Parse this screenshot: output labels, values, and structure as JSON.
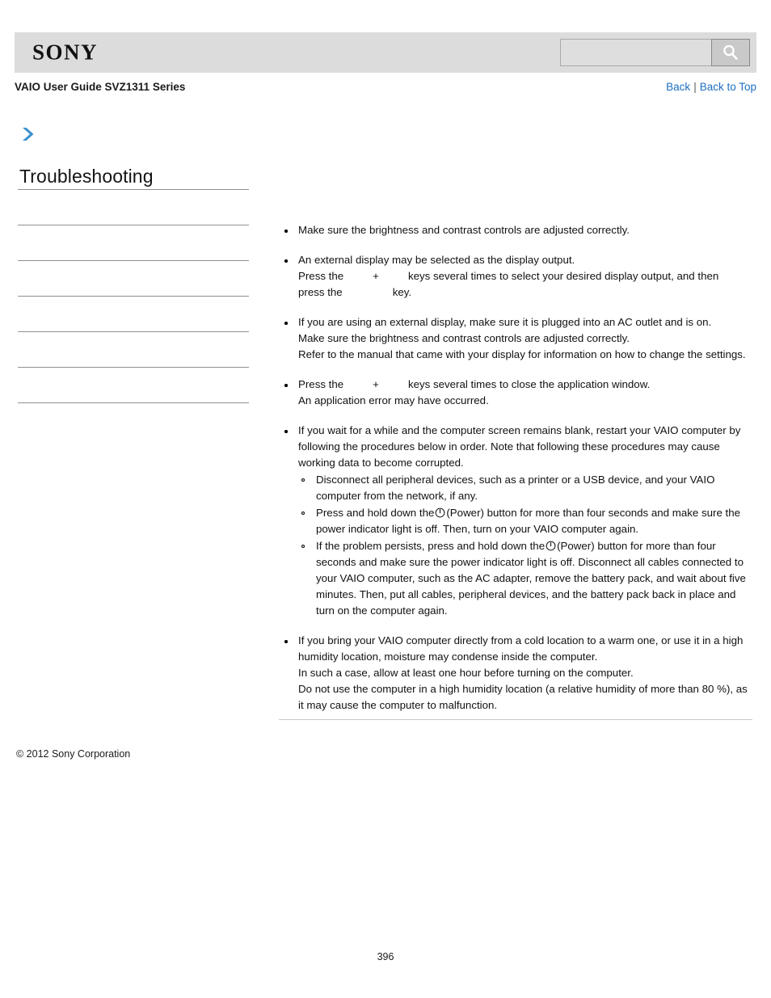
{
  "header": {
    "logo_text": "SONY",
    "search": {
      "value": "",
      "placeholder": "",
      "button_icon": "search-icon"
    },
    "guide_title": "VAIO User Guide SVZ1311 Series",
    "links": {
      "back": "Back",
      "separator": "|",
      "back_to_top": "Back to Top"
    },
    "link_color": "#1d6fc1",
    "bar_color": "#dcdcdc"
  },
  "sidebar": {
    "arrow_icon": "chevron-right-icon",
    "arrow_color": "#3a8fce",
    "heading": "Troubleshooting",
    "items": [
      {
        "label": ""
      },
      {
        "label": ""
      },
      {
        "label": ""
      },
      {
        "label": ""
      },
      {
        "label": ""
      },
      {
        "label": ""
      }
    ]
  },
  "content": {
    "bullets": [
      {
        "lines": [
          "Make sure the brightness and contrast controls are adjusted correctly."
        ]
      },
      {
        "lines": [
          "An external display may be selected as the display output.",
          "Press the",
          "keys several times to select your desired display output, and then",
          "press the",
          "key."
        ]
      },
      {
        "lines": [
          "If you are using an external display, make sure it is plugged into an AC outlet and is on.",
          "Make sure the brightness and contrast controls are adjusted correctly.",
          "Refer to the manual that came with your display for information on how to change the settings."
        ]
      },
      {
        "lines": [
          "Press the",
          "keys several times to close the application window.",
          "An application error may have occurred."
        ]
      },
      {
        "lines": [
          "If you wait for a while and the computer screen remains blank, restart your VAIO computer by following the procedures below in order. Note that following these procedures may cause working data to become corrupted."
        ],
        "sub_bullets": [
          "Disconnect all peripheral devices, such as a printer or a USB device, and your VAIO computer from the network, if any.",
          "Press and hold down the",
          "(Power) button for more than four seconds and make sure the power indicator light is off. Then, turn on your VAIO computer again.",
          "If the problem persists, press and hold down the",
          "(Power) button for more than four seconds and make sure the power indicator light is off. Disconnect all cables connected to your VAIO computer, such as the AC adapter, remove the battery pack, and wait about five minutes. Then, put all cables, peripheral devices, and the battery pack back in place and turn on the computer again."
        ]
      },
      {
        "lines": [
          "If you bring your VAIO computer directly from a cold location to a warm one, or use it in a high humidity location, moisture may condense inside the computer.",
          "In such a case, allow at least one hour before turning on the computer.",
          "Do not use the computer in a high humidity location (a relative humidity of more than 80 %), as it may cause the computer to malfunction."
        ]
      }
    ],
    "plus_sign": "+"
  },
  "footer": {
    "copyright": "© 2012 Sony Corporation",
    "page_number": "396"
  }
}
